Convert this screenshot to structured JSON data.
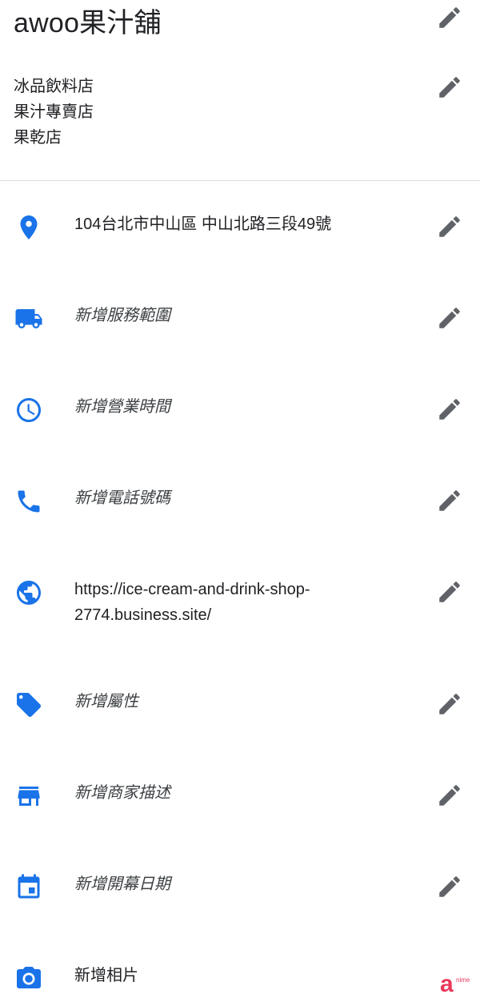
{
  "business": {
    "name": "awoo果汁舖",
    "categories": [
      "冰品飲料店",
      "果汁專賣店",
      "果乾店"
    ]
  },
  "rows": {
    "address": {
      "text": "104台北市中山區 中山北路三段49號",
      "icon": "location-pin-icon"
    },
    "service_area": {
      "text": "新增服務範圍",
      "icon": "truck-icon"
    },
    "hours": {
      "text": "新增營業時間",
      "icon": "clock-icon"
    },
    "phone": {
      "text": "新增電話號碼",
      "icon": "phone-icon"
    },
    "website": {
      "line1": "https://ice-cream-and-drink-shop-",
      "line2": "2774.business.site/",
      "icon": "globe-icon"
    },
    "attributes": {
      "text": "新增屬性",
      "icon": "tag-icon"
    },
    "description": {
      "text": "新增商家描述",
      "icon": "storefront-icon"
    },
    "opening_date": {
      "text": "新增開幕日期",
      "icon": "calendar-icon"
    },
    "photos": {
      "text": "新增相片",
      "icon": "camera-icon"
    }
  },
  "colors": {
    "accent": "#1a73e8",
    "edit_icon": "#5f6368",
    "divider": "#dadce0",
    "watermark": "#e8385a"
  }
}
